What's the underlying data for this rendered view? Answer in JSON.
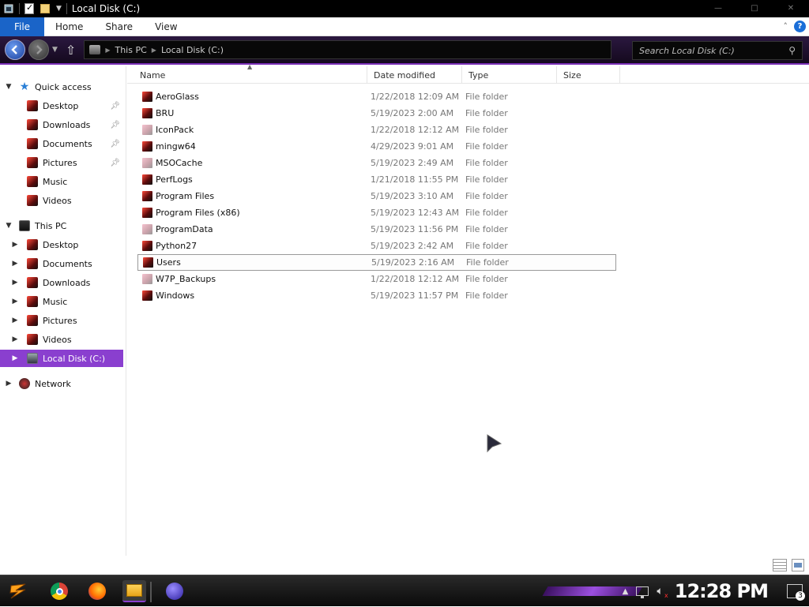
{
  "window": {
    "title": "Local Disk (C:)",
    "controls": {
      "minimize": "—",
      "maximize": "□",
      "close": "✕"
    }
  },
  "ribbon": {
    "tabs": [
      "File",
      "Home",
      "Share",
      "View"
    ],
    "expand_glyph": "˄",
    "help_glyph": "?"
  },
  "address": {
    "breadcrumbs": [
      "This PC",
      "Local Disk (C:)"
    ],
    "search_placeholder": "Search Local Disk (C:)"
  },
  "navpane": {
    "quick_access": {
      "label": "Quick access",
      "items": [
        {
          "label": "Desktop",
          "pinned": true
        },
        {
          "label": "Downloads",
          "pinned": true
        },
        {
          "label": "Documents",
          "pinned": true
        },
        {
          "label": "Pictures",
          "pinned": true
        },
        {
          "label": "Music",
          "pinned": false
        },
        {
          "label": "Videos",
          "pinned": false
        }
      ]
    },
    "this_pc": {
      "label": "This PC",
      "items": [
        "Desktop",
        "Documents",
        "Downloads",
        "Music",
        "Pictures",
        "Videos",
        "Local Disk (C:)"
      ],
      "selected": "Local Disk (C:)"
    },
    "network": {
      "label": "Network"
    }
  },
  "columns": {
    "name": "Name",
    "date": "Date modified",
    "type": "Type",
    "size": "Size"
  },
  "files": [
    {
      "name": "AeroGlass",
      "date": "1/22/2018 12:09 AM",
      "type": "File folder",
      "icon": "folder-dark"
    },
    {
      "name": "BRU",
      "date": "5/19/2023 2:00 AM",
      "type": "File folder",
      "icon": "folder-dark"
    },
    {
      "name": "IconPack",
      "date": "1/22/2018 12:12 AM",
      "type": "File folder",
      "icon": "folder-pale"
    },
    {
      "name": "mingw64",
      "date": "4/29/2023 9:01 AM",
      "type": "File folder",
      "icon": "folder-dark"
    },
    {
      "name": "MSOCache",
      "date": "5/19/2023 2:49 AM",
      "type": "File folder",
      "icon": "folder-pale"
    },
    {
      "name": "PerfLogs",
      "date": "1/21/2018 11:55 PM",
      "type": "File folder",
      "icon": "folder-dark"
    },
    {
      "name": "Program Files",
      "date": "5/19/2023 3:10 AM",
      "type": "File folder",
      "icon": "folder-dark"
    },
    {
      "name": "Program Files (x86)",
      "date": "5/19/2023 12:43 AM",
      "type": "File folder",
      "icon": "folder-dark"
    },
    {
      "name": "ProgramData",
      "date": "5/19/2023 11:56 PM",
      "type": "File folder",
      "icon": "folder-pale"
    },
    {
      "name": "Python27",
      "date": "5/19/2023 2:42 AM",
      "type": "File folder",
      "icon": "folder-dark"
    },
    {
      "name": "Users",
      "date": "5/19/2023 2:16 AM",
      "type": "File folder",
      "icon": "folder-dark",
      "focused": true
    },
    {
      "name": "W7P_Backups",
      "date": "1/22/2018 12:12 AM",
      "type": "File folder",
      "icon": "folder-pale"
    },
    {
      "name": "Windows",
      "date": "5/19/2023 11:57 PM",
      "type": "File folder",
      "icon": "folder-dark"
    }
  ],
  "taskbar": {
    "apps": [
      "chrome-icon",
      "firefox-icon",
      "file-explorer-icon",
      "globe-app-icon"
    ],
    "active_app": "file-explorer-icon",
    "clock": "12:28 PM",
    "notification_count": "3"
  },
  "colors": {
    "accent_purple": "#8a3fcf",
    "file_tab_blue": "#1a64c8",
    "titlebar": "#000000"
  }
}
